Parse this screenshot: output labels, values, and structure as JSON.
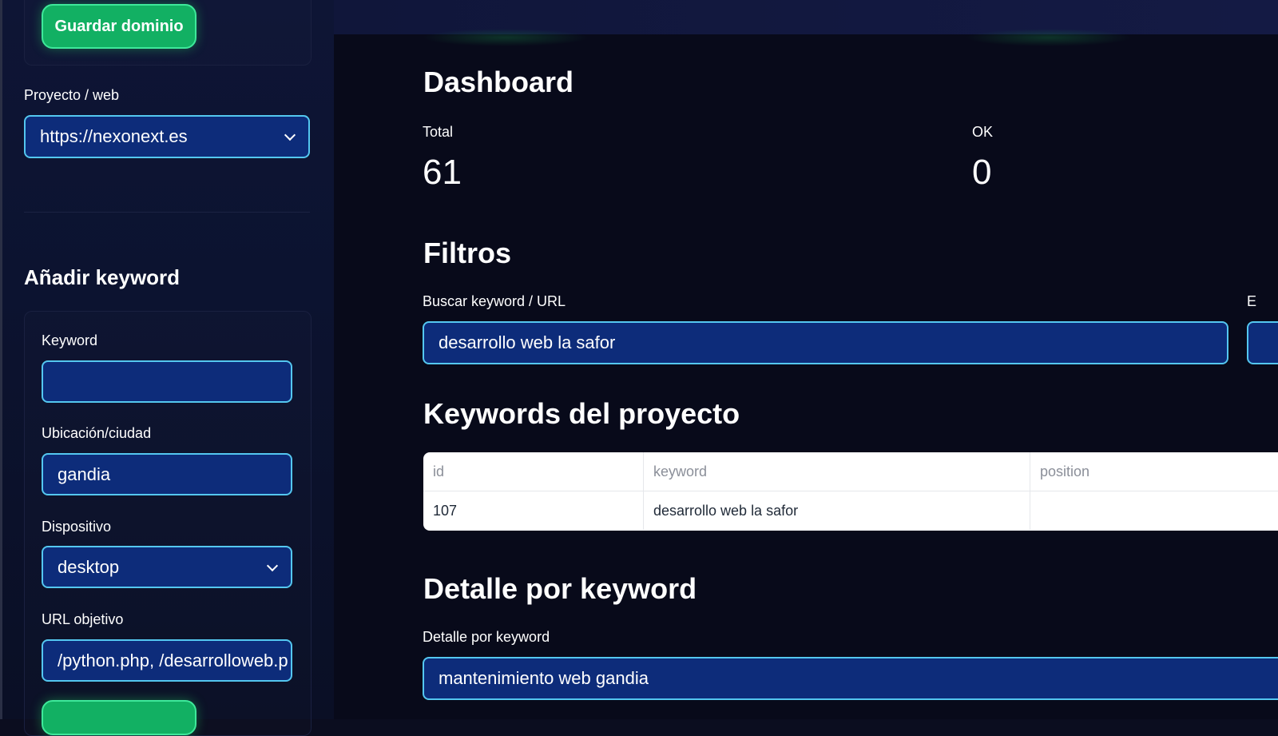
{
  "sidebar": {
    "save_domain_button": "Guardar dominio",
    "project_label": "Proyecto / web",
    "project_value": "https://nexonext.es",
    "add_keyword_title": "Añadir keyword",
    "form": {
      "keyword_label": "Keyword",
      "keyword_value": "",
      "location_label": "Ubicación/ciudad",
      "location_value": "gandia",
      "device_label": "Dispositivo",
      "device_value": "desktop",
      "target_url_label": "URL objetivo",
      "target_url_value": "/python.php, /desarrolloweb.p"
    }
  },
  "main": {
    "dashboard_title": "Dashboard",
    "metrics": [
      {
        "label": "Total",
        "value": "61"
      },
      {
        "label": "OK",
        "value": "0"
      }
    ],
    "filters_title": "Filtros",
    "search_label": "Buscar keyword / URL",
    "search_value": "desarrollo web la safor",
    "clipped_label_char": "E",
    "keywords_title": "Keywords del proyecto",
    "table": {
      "columns": [
        "id",
        "keyword",
        "position"
      ],
      "rows": [
        [
          "107",
          "desarrollo web la safor",
          ""
        ]
      ]
    },
    "detail_title": "Detalle por keyword",
    "detail_label": "Detalle por keyword",
    "detail_value": "mantenimiento web gandia"
  },
  "colors": {
    "accent_green": "#12b063",
    "field_bg": "#0d2c7a",
    "field_border": "#54c7f0",
    "page_bg": "#080a1a"
  },
  "icons": {
    "select_chevron": "chevron-down-icon"
  }
}
